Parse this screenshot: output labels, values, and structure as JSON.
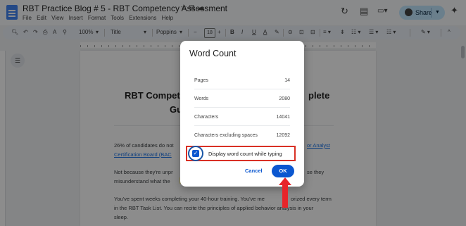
{
  "header": {
    "title": "RBT Practice Blog # 5 - RBT Competency Assessment",
    "title_icons": "☆ ⧉ ☁",
    "menu": [
      "File",
      "Edit",
      "View",
      "Insert",
      "Format",
      "Tools",
      "Extensions",
      "Help"
    ],
    "history_icon": "↻",
    "comments_icon": "▤",
    "meet_icon": "▭▾",
    "share_label": "Share",
    "gemini_icon": "✦"
  },
  "toolbar": {
    "zoom": "100%",
    "style": "Title",
    "font": "Poppins",
    "font_size": "18",
    "minus": "−",
    "plus": "+",
    "bold": "B",
    "italic": "I",
    "underline": "U",
    "text_color": "A",
    "highlight": "✎",
    "link": "⊝",
    "comment": "⊡",
    "image": "⊟",
    "align": "≡ ▾",
    "line_spacing": "⇟",
    "checklist": "☷ ▾",
    "bullets": "☰ ▾",
    "numbered": "☷ ▾",
    "editing": "✎ ▾",
    "collapse": "^"
  },
  "document": {
    "heading_left": "RBT Compet",
    "heading_right": "plete",
    "heading_line2": "Gu",
    "para1_start": "26% of candidates do not",
    "para1_link_end": "or Analyst",
    "para1_link2": "Certification Board (BAC",
    "para2_start": "Not because they're unpr",
    "para2_end": "se they",
    "para2_line2": "misunderstand what the",
    "para3_line1_a": "You've spent weeks completing your 40-hour training. You've me",
    "para3_line1_b": "orized every term",
    "para3_line2": "in the RBT Task List. You can recite the principles of applied behavior analysis in your",
    "para3_line3": "sleep."
  },
  "dialog": {
    "title": "Word Count",
    "rows": [
      {
        "label": "Pages",
        "value": "14"
      },
      {
        "label": "Words",
        "value": "2080"
      },
      {
        "label": "Characters",
        "value": "14041"
      },
      {
        "label": "Characters excluding spaces",
        "value": "12092"
      }
    ],
    "checkbox_label": "Display word count while typing",
    "checkbox_checked": true,
    "cancel_label": "Cancel",
    "ok_label": "OK"
  },
  "colors": {
    "accent": "#0b57d0",
    "annotation_red": "#d93025",
    "arrow_red": "#e8252a",
    "share_bg": "#c2e7ff"
  }
}
